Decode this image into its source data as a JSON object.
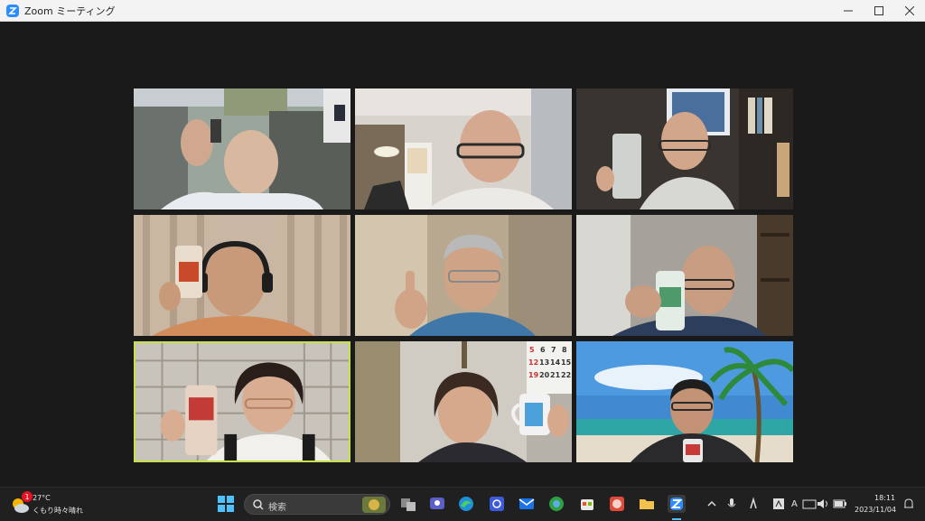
{
  "window": {
    "title": "Zoom ミーティング"
  },
  "participants": [
    {
      "row": 1,
      "col": 1,
      "active": false
    },
    {
      "row": 1,
      "col": 2,
      "active": false
    },
    {
      "row": 1,
      "col": 3,
      "active": false
    },
    {
      "row": 2,
      "col": 1,
      "active": false
    },
    {
      "row": 2,
      "col": 2,
      "active": false
    },
    {
      "row": 2,
      "col": 3,
      "active": false
    },
    {
      "row": 3,
      "col": 1,
      "active": true
    },
    {
      "row": 3,
      "col": 2,
      "active": false
    },
    {
      "row": 3,
      "col": 3,
      "active": false
    }
  ],
  "calendar_numbers": [
    "5",
    "6",
    "7",
    "8",
    "12",
    "13",
    "14",
    "15",
    "19",
    "20",
    "21",
    "22"
  ],
  "taskbar": {
    "weather_badge": "1",
    "weather_temp": "27°C",
    "weather_cond": "くもり時々晴れ",
    "search_placeholder": "検索",
    "clock_time": "18:11",
    "clock_date": "2023/11/04",
    "ime_mode": "A"
  },
  "colors": {
    "accent": "#2d8cff",
    "active_border": "#c8e04a",
    "taskbar": "#202020"
  }
}
